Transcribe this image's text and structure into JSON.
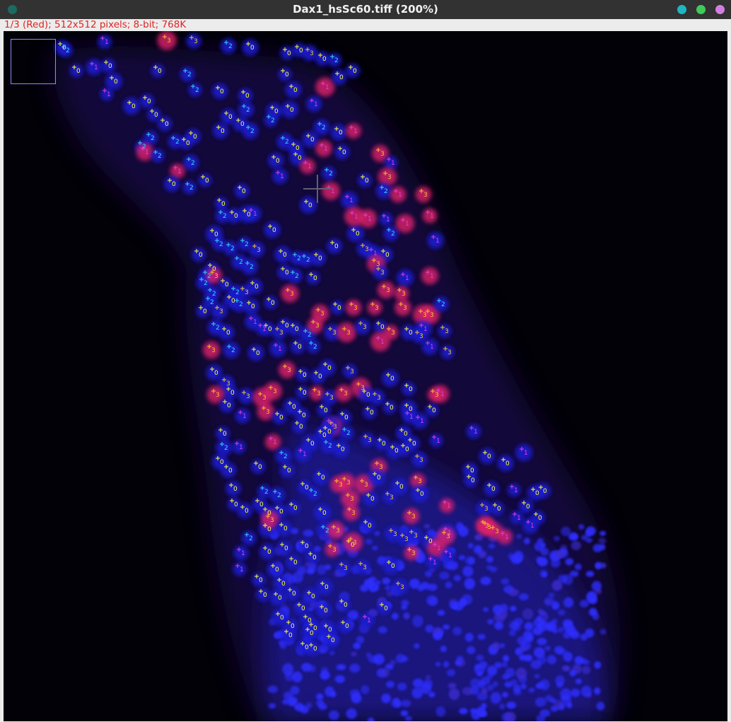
{
  "window": {
    "title": "Dax1_hsSc60.tiff (200%)",
    "traffic_lights": [
      "#1fb6c4",
      "#3ecb5a",
      "#d17ee3"
    ],
    "close_dot_color": "#1b6b62"
  },
  "status_bar": {
    "text": "1/3 (Red); 512x512 pixels; 8-bit; 768K",
    "color": "#e02323"
  },
  "image": {
    "channel": "Red",
    "stack_position": "1/3",
    "zoom": "200%",
    "palette": {
      "background": "#020107",
      "nuclei_blue": "#1a1ad8",
      "nuclei_red": "#e0246a"
    }
  },
  "marker_colors": {
    "0": "#ffff33",
    "1": "#e040e0",
    "2": "#33ddee",
    "3": "#f4c430"
  },
  "markers": [
    [
      "0",
      85,
      62
    ],
    [
      "2",
      90,
      66
    ],
    [
      "1",
      145,
      54
    ],
    [
      "3",
      233,
      52
    ],
    [
      "3",
      271,
      53
    ],
    [
      "2",
      320,
      60
    ],
    [
      "0",
      351,
      62
    ],
    [
      "0",
      403,
      70
    ],
    [
      "0",
      420,
      66
    ],
    [
      "3",
      435,
      70
    ],
    [
      "0",
      453,
      78
    ],
    [
      "2",
      470,
      80
    ],
    [
      "1",
      130,
      90
    ],
    [
      "0",
      105,
      95
    ],
    [
      "0",
      150,
      88
    ],
    [
      "0",
      220,
      95
    ],
    [
      "2",
      262,
      100
    ],
    [
      "2",
      273,
      122
    ],
    [
      "0",
      308,
      124
    ],
    [
      "0",
      344,
      130
    ],
    [
      "0",
      400,
      100
    ],
    [
      "0",
      412,
      122
    ],
    [
      "1",
      457,
      118
    ],
    [
      "0",
      477,
      104
    ],
    [
      "0",
      496,
      95
    ],
    [
      "1",
      148,
      128
    ],
    [
      "0",
      158,
      110
    ],
    [
      "0",
      183,
      145
    ],
    [
      "0",
      205,
      138
    ],
    [
      "0",
      215,
      157
    ],
    [
      "0",
      230,
      170
    ],
    [
      "2",
      245,
      195
    ],
    [
      "2",
      210,
      190
    ],
    [
      "2",
      198,
      202
    ],
    [
      "1",
      202,
      210
    ],
    [
      "2",
      220,
      215
    ],
    [
      "0",
      260,
      197
    ],
    [
      "0",
      270,
      188
    ],
    [
      "2",
      267,
      225
    ],
    [
      "1",
      248,
      237
    ],
    [
      "0",
      240,
      255
    ],
    [
      "2",
      265,
      260
    ],
    [
      "0",
      287,
      250
    ],
    [
      "0",
      309,
      180
    ],
    [
      "0",
      320,
      160
    ],
    [
      "0",
      337,
      170
    ],
    [
      "2",
      345,
      150
    ],
    [
      "2",
      351,
      180
    ],
    [
      "0",
      385,
      152
    ],
    [
      "0",
      407,
      150
    ],
    [
      "1",
      441,
      142
    ],
    [
      "2",
      452,
      175
    ],
    [
      "0",
      476,
      182
    ],
    [
      "2",
      380,
      165
    ],
    [
      "2",
      400,
      195
    ],
    [
      "0",
      415,
      204
    ],
    [
      "0",
      436,
      192
    ],
    [
      "1",
      455,
      205
    ],
    [
      "0",
      481,
      210
    ],
    [
      "1",
      497,
      180
    ],
    [
      "0",
      387,
      222
    ],
    [
      "1",
      393,
      244
    ],
    [
      "0",
      418,
      218
    ],
    [
      "1",
      432,
      230
    ],
    [
      "2",
      462,
      240
    ],
    [
      "3",
      535,
      212
    ],
    [
      "1",
      550,
      225
    ],
    [
      "3",
      545,
      245
    ],
    [
      "0",
      513,
      250
    ],
    [
      "2",
      540,
      265
    ],
    [
      "1",
      560,
      270
    ],
    [
      "3",
      596,
      270
    ],
    [
      "1",
      491,
      278
    ],
    [
      "0",
      433,
      285
    ],
    [
      "1",
      465,
      265
    ],
    [
      "0",
      339,
      265
    ],
    [
      "0",
      310,
      283
    ],
    [
      "2",
      312,
      300
    ],
    [
      "0",
      328,
      300
    ],
    [
      "0",
      346,
      298
    ],
    [
      "1",
      355,
      297
    ],
    [
      "0",
      382,
      320
    ],
    [
      "0",
      300,
      326
    ],
    [
      "2",
      307,
      340
    ],
    [
      "2",
      323,
      346
    ],
    [
      "2",
      343,
      340
    ],
    [
      "3",
      360,
      348
    ],
    [
      "0",
      278,
      355
    ],
    [
      "2",
      335,
      365
    ],
    [
      "2",
      350,
      372
    ],
    [
      "0",
      397,
      355
    ],
    [
      "2",
      417,
      360
    ],
    [
      "2",
      430,
      362
    ],
    [
      "0",
      447,
      360
    ],
    [
      "0",
      470,
      343
    ],
    [
      "0",
      500,
      325
    ],
    [
      "3",
      513,
      347
    ],
    [
      "1",
      525,
      353
    ],
    [
      "0",
      542,
      355
    ],
    [
      "3",
      529,
      368
    ],
    [
      "3",
      535,
      380
    ],
    [
      "1",
      570,
      388
    ],
    [
      "1",
      605,
      385
    ],
    [
      "1",
      498,
      301
    ],
    [
      "1",
      517,
      304
    ],
    [
      "1",
      543,
      305
    ],
    [
      "2",
      550,
      325
    ],
    [
      "1",
      570,
      311
    ],
    [
      "1",
      605,
      300
    ],
    [
      "1",
      613,
      335
    ],
    [
      "0",
      297,
      375
    ],
    [
      "2",
      290,
      385
    ],
    [
      "2",
      285,
      395
    ],
    [
      "3",
      300,
      385
    ],
    [
      "0",
      315,
      397
    ],
    [
      "2",
      330,
      408
    ],
    [
      "0",
      357,
      400
    ],
    [
      "0",
      400,
      380
    ],
    [
      "2",
      414,
      385
    ],
    [
      "0",
      440,
      388
    ],
    [
      "3",
      407,
      410
    ],
    [
      "0",
      380,
      423
    ],
    [
      "3",
      343,
      408
    ],
    [
      "2",
      297,
      410
    ],
    [
      "2",
      294,
      422
    ],
    [
      "0",
      284,
      435
    ],
    [
      "0",
      324,
      420
    ],
    [
      "3",
      307,
      435
    ],
    [
      "2",
      335,
      425
    ],
    [
      "0",
      352,
      428
    ],
    [
      "1",
      355,
      450
    ],
    [
      "3",
      450,
      438
    ],
    [
      "0",
      474,
      430
    ],
    [
      "3",
      497,
      430
    ],
    [
      "3",
      527,
      430
    ],
    [
      "3",
      543,
      405
    ],
    [
      "3",
      565,
      410
    ],
    [
      "3",
      567,
      430
    ],
    [
      "3",
      595,
      440
    ],
    [
      "3",
      605,
      440
    ],
    [
      "2",
      621,
      425
    ],
    [
      "1",
      596,
      460
    ],
    [
      "3",
      626,
      463
    ],
    [
      "1",
      605,
      485
    ],
    [
      "3",
      630,
      493
    ],
    [
      "0",
      317,
      465
    ],
    [
      "2",
      302,
      458
    ],
    [
      "3",
      296,
      490
    ],
    [
      "2",
      324,
      490
    ],
    [
      "0",
      359,
      494
    ],
    [
      "1",
      368,
      460
    ],
    [
      "0",
      376,
      460
    ],
    [
      "3",
      392,
      465
    ],
    [
      "0",
      400,
      455
    ],
    [
      "0",
      414,
      460
    ],
    [
      "2",
      432,
      468
    ],
    [
      "3",
      443,
      455
    ],
    [
      "2",
      440,
      485
    ],
    [
      "0",
      418,
      485
    ],
    [
      "1",
      390,
      488
    ],
    [
      "3",
      467,
      465
    ],
    [
      "3",
      487,
      465
    ],
    [
      "3",
      510,
      457
    ],
    [
      "0",
      535,
      457
    ],
    [
      "3",
      550,
      465
    ],
    [
      "0",
      575,
      465
    ],
    [
      "3",
      590,
      470
    ],
    [
      "1",
      535,
      478
    ],
    [
      "0",
      300,
      522
    ],
    [
      "3",
      317,
      537
    ],
    [
      "0",
      323,
      550
    ],
    [
      "3",
      345,
      555
    ],
    [
      "3",
      302,
      553
    ],
    [
      "0",
      318,
      568
    ],
    [
      "1",
      340,
      583
    ],
    [
      "3",
      368,
      557
    ],
    [
      "3",
      383,
      548
    ],
    [
      "3",
      373,
      577
    ],
    [
      "0",
      392,
      585
    ],
    [
      "0",
      410,
      570
    ],
    [
      "0",
      424,
      582
    ],
    [
      "0",
      420,
      598
    ],
    [
      "3",
      403,
      518
    ],
    [
      "0",
      425,
      525
    ],
    [
      "0",
      447,
      527
    ],
    [
      "0",
      460,
      515
    ],
    [
      "3",
      492,
      520
    ],
    [
      "3",
      507,
      543
    ],
    [
      "0",
      425,
      550
    ],
    [
      "3",
      445,
      551
    ],
    [
      "3",
      463,
      557
    ],
    [
      "3",
      483,
      551
    ],
    [
      "0",
      515,
      553
    ],
    [
      "3",
      530,
      557
    ],
    [
      "0",
      575,
      545
    ],
    [
      "0",
      549,
      530
    ],
    [
      "3",
      612,
      553
    ],
    [
      "1",
      620,
      552
    ],
    [
      "0",
      608,
      575
    ],
    [
      "0",
      575,
      573
    ],
    [
      "1",
      591,
      590
    ],
    [
      "1",
      576,
      584
    ],
    [
      "0",
      548,
      571
    ],
    [
      "0",
      455,
      575
    ],
    [
      "0",
      484,
      585
    ],
    [
      "3",
      468,
      598
    ],
    [
      "0",
      520,
      578
    ],
    [
      "0",
      312,
      608
    ],
    [
      "2",
      314,
      628
    ],
    [
      "1",
      335,
      627
    ],
    [
      "1",
      383,
      620
    ],
    [
      "0",
      436,
      622
    ],
    [
      "0",
      453,
      610
    ],
    [
      "0",
      460,
      605
    ],
    [
      "1",
      465,
      595
    ],
    [
      "2",
      487,
      607
    ],
    [
      "0",
      479,
      630
    ],
    [
      "2",
      461,
      625
    ],
    [
      "3",
      517,
      617
    ],
    [
      "0",
      537,
      622
    ],
    [
      "0",
      555,
      632
    ],
    [
      "0",
      570,
      630
    ],
    [
      "3",
      590,
      645
    ],
    [
      "0",
      568,
      608
    ],
    [
      "1",
      614,
      618
    ],
    [
      "0",
      580,
      622
    ],
    [
      "1",
      667,
      605
    ],
    [
      "0",
      686,
      640
    ],
    [
      "0",
      712,
      650
    ],
    [
      "1",
      738,
      635
    ],
    [
      "2",
      398,
      640
    ],
    [
      "0",
      403,
      660
    ],
    [
      "1",
      425,
      637
    ],
    [
      "0",
      362,
      655
    ],
    [
      "0",
      308,
      648
    ],
    [
      "0",
      320,
      660
    ],
    [
      "0",
      327,
      686
    ],
    [
      "0",
      328,
      708
    ],
    [
      "0",
      343,
      717
    ],
    [
      "0",
      364,
      708
    ],
    [
      "0",
      375,
      720
    ],
    [
      "2",
      371,
      690
    ],
    [
      "2",
      389,
      695
    ],
    [
      "0",
      392,
      718
    ],
    [
      "0",
      412,
      713
    ],
    [
      "0",
      428,
      684
    ],
    [
      "2",
      440,
      693
    ],
    [
      "0",
      451,
      670
    ],
    [
      "3",
      476,
      680
    ],
    [
      "3",
      487,
      677
    ],
    [
      "3",
      492,
      700
    ],
    [
      "3",
      512,
      680
    ],
    [
      "0",
      521,
      700
    ],
    [
      "3",
      533,
      655
    ],
    [
      "0",
      530,
      670
    ],
    [
      "3",
      548,
      698
    ],
    [
      "0",
      562,
      683
    ],
    [
      "3",
      588,
      675
    ],
    [
      "0",
      591,
      693
    ],
    [
      "0",
      663,
      674
    ],
    [
      "0",
      692,
      686
    ],
    [
      "0",
      662,
      660
    ],
    [
      "1",
      724,
      688
    ],
    [
      "0",
      754,
      692
    ],
    [
      "0",
      765,
      689
    ],
    [
      "1",
      629,
      710
    ],
    [
      "3",
      682,
      714
    ],
    [
      "0",
      700,
      714
    ],
    [
      "0",
      741,
      711
    ],
    [
      "0",
      758,
      727
    ],
    [
      "1",
      747,
      738
    ],
    [
      "1",
      728,
      727
    ],
    [
      "3",
      683,
      738
    ],
    [
      "3",
      686,
      740
    ],
    [
      "3",
      697,
      746
    ],
    [
      "1",
      711,
      754
    ],
    [
      "3",
      579,
      725
    ],
    [
      "2",
      457,
      745
    ],
    [
      "3",
      472,
      745
    ],
    [
      "0",
      453,
      720
    ],
    [
      "3",
      494,
      720
    ],
    [
      "0",
      493,
      765
    ],
    [
      "0",
      517,
      738
    ],
    [
      "3",
      553,
      750
    ],
    [
      "3",
      569,
      757
    ],
    [
      "3",
      582,
      752
    ],
    [
      "0",
      603,
      760
    ],
    [
      "1",
      630,
      748
    ],
    [
      "1",
      615,
      770
    ],
    [
      "3",
      579,
      777
    ],
    [
      "1",
      609,
      790
    ],
    [
      "1",
      631,
      780
    ],
    [
      "3",
      628,
      753
    ],
    [
      "0",
      428,
      767
    ],
    [
      "3",
      467,
      772
    ],
    [
      "3",
      496,
      762
    ],
    [
      "0",
      375,
      743
    ],
    [
      "3",
      379,
      730
    ],
    [
      "0",
      398,
      742
    ],
    [
      "2",
      349,
      756
    ],
    [
      "1",
      338,
      777
    ],
    [
      "0",
      375,
      775
    ],
    [
      "0",
      399,
      770
    ],
    [
      "0",
      412,
      790
    ],
    [
      "0",
      439,
      783
    ],
    [
      "3",
      483,
      798
    ],
    [
      "3",
      510,
      797
    ],
    [
      "0",
      550,
      795
    ],
    [
      "1",
      336,
      800
    ],
    [
      "0",
      363,
      815
    ],
    [
      "0",
      386,
      800
    ],
    [
      "0",
      395,
      820
    ],
    [
      "0",
      410,
      834
    ],
    [
      "0",
      437,
      838
    ],
    [
      "0",
      456,
      825
    ],
    [
      "3",
      563,
      825
    ],
    [
      "0",
      369,
      836
    ],
    [
      "0",
      390,
      840
    ],
    [
      "0",
      423,
      855
    ],
    [
      "0",
      455,
      858
    ],
    [
      "0",
      483,
      850
    ],
    [
      "0",
      540,
      855
    ],
    [
      "0",
      393,
      868
    ],
    [
      "0",
      408,
      880
    ],
    [
      "0",
      432,
      872
    ],
    [
      "0",
      461,
      885
    ],
    [
      "0",
      485,
      880
    ],
    [
      "1",
      516,
      872
    ],
    [
      "0",
      405,
      893
    ],
    [
      "0",
      435,
      890
    ],
    [
      "0",
      440,
      883
    ],
    [
      "0",
      465,
      900
    ],
    [
      "0",
      428,
      910
    ],
    [
      "0",
      440,
      912
    ]
  ]
}
